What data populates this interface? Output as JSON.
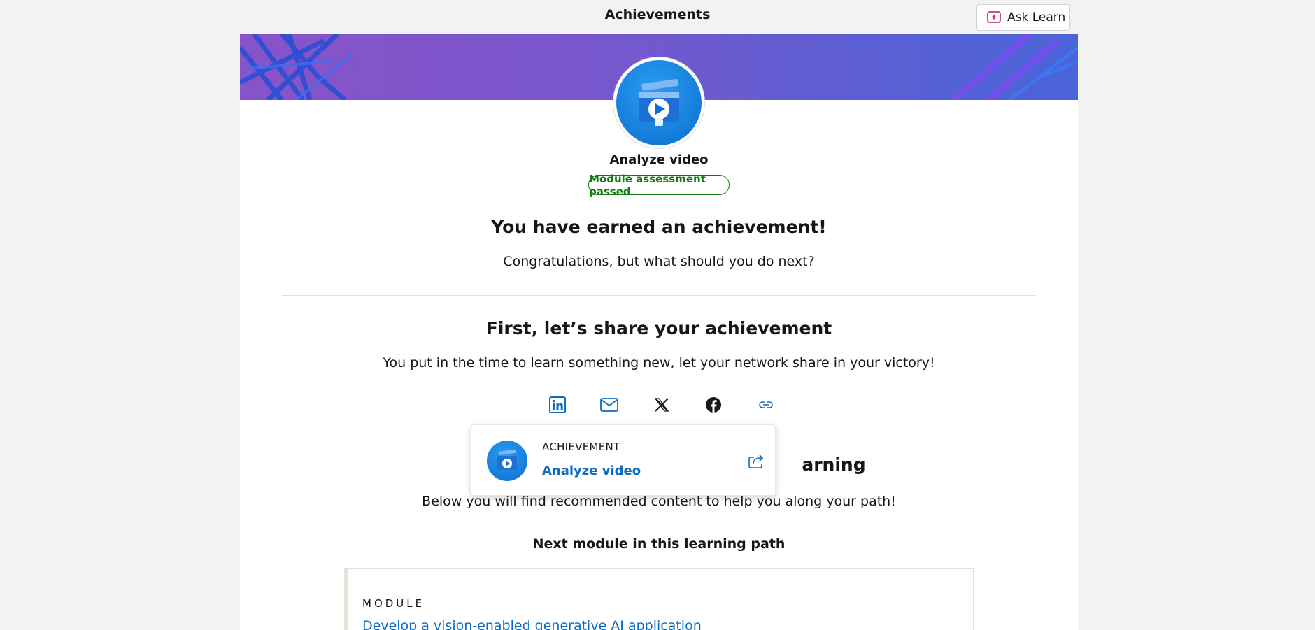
{
  "header": {
    "title": "Achievements",
    "ask_learn_label": "Ask Learn"
  },
  "achievement": {
    "name": "Analyze video",
    "status": "Module assessment passed",
    "heading": "You have earned an achievement!",
    "subheading": "Congratulations, but what should you do next?"
  },
  "share": {
    "heading": "First, let’s share your achievement",
    "text": "You put in the time to learn something new, let your network share in your victory!",
    "icons": [
      "linkedin-icon",
      "email-icon",
      "x-icon",
      "facebook-icon",
      "link-icon"
    ]
  },
  "popup": {
    "category": "ACHIEVEMENT",
    "name": "Analyze video"
  },
  "continue": {
    "heading_tail": "arning",
    "text": "Below you will find recommended content to help you along your path!",
    "next_label": "Next module in this learning path",
    "card": {
      "kind": "MODULE",
      "title": "Develop a vision-enabled generative AI application"
    }
  },
  "colors": {
    "link": "#0f6cbd",
    "success": "#107c10",
    "banner_start": "#8754c8",
    "banner_end": "#4a63d8"
  }
}
